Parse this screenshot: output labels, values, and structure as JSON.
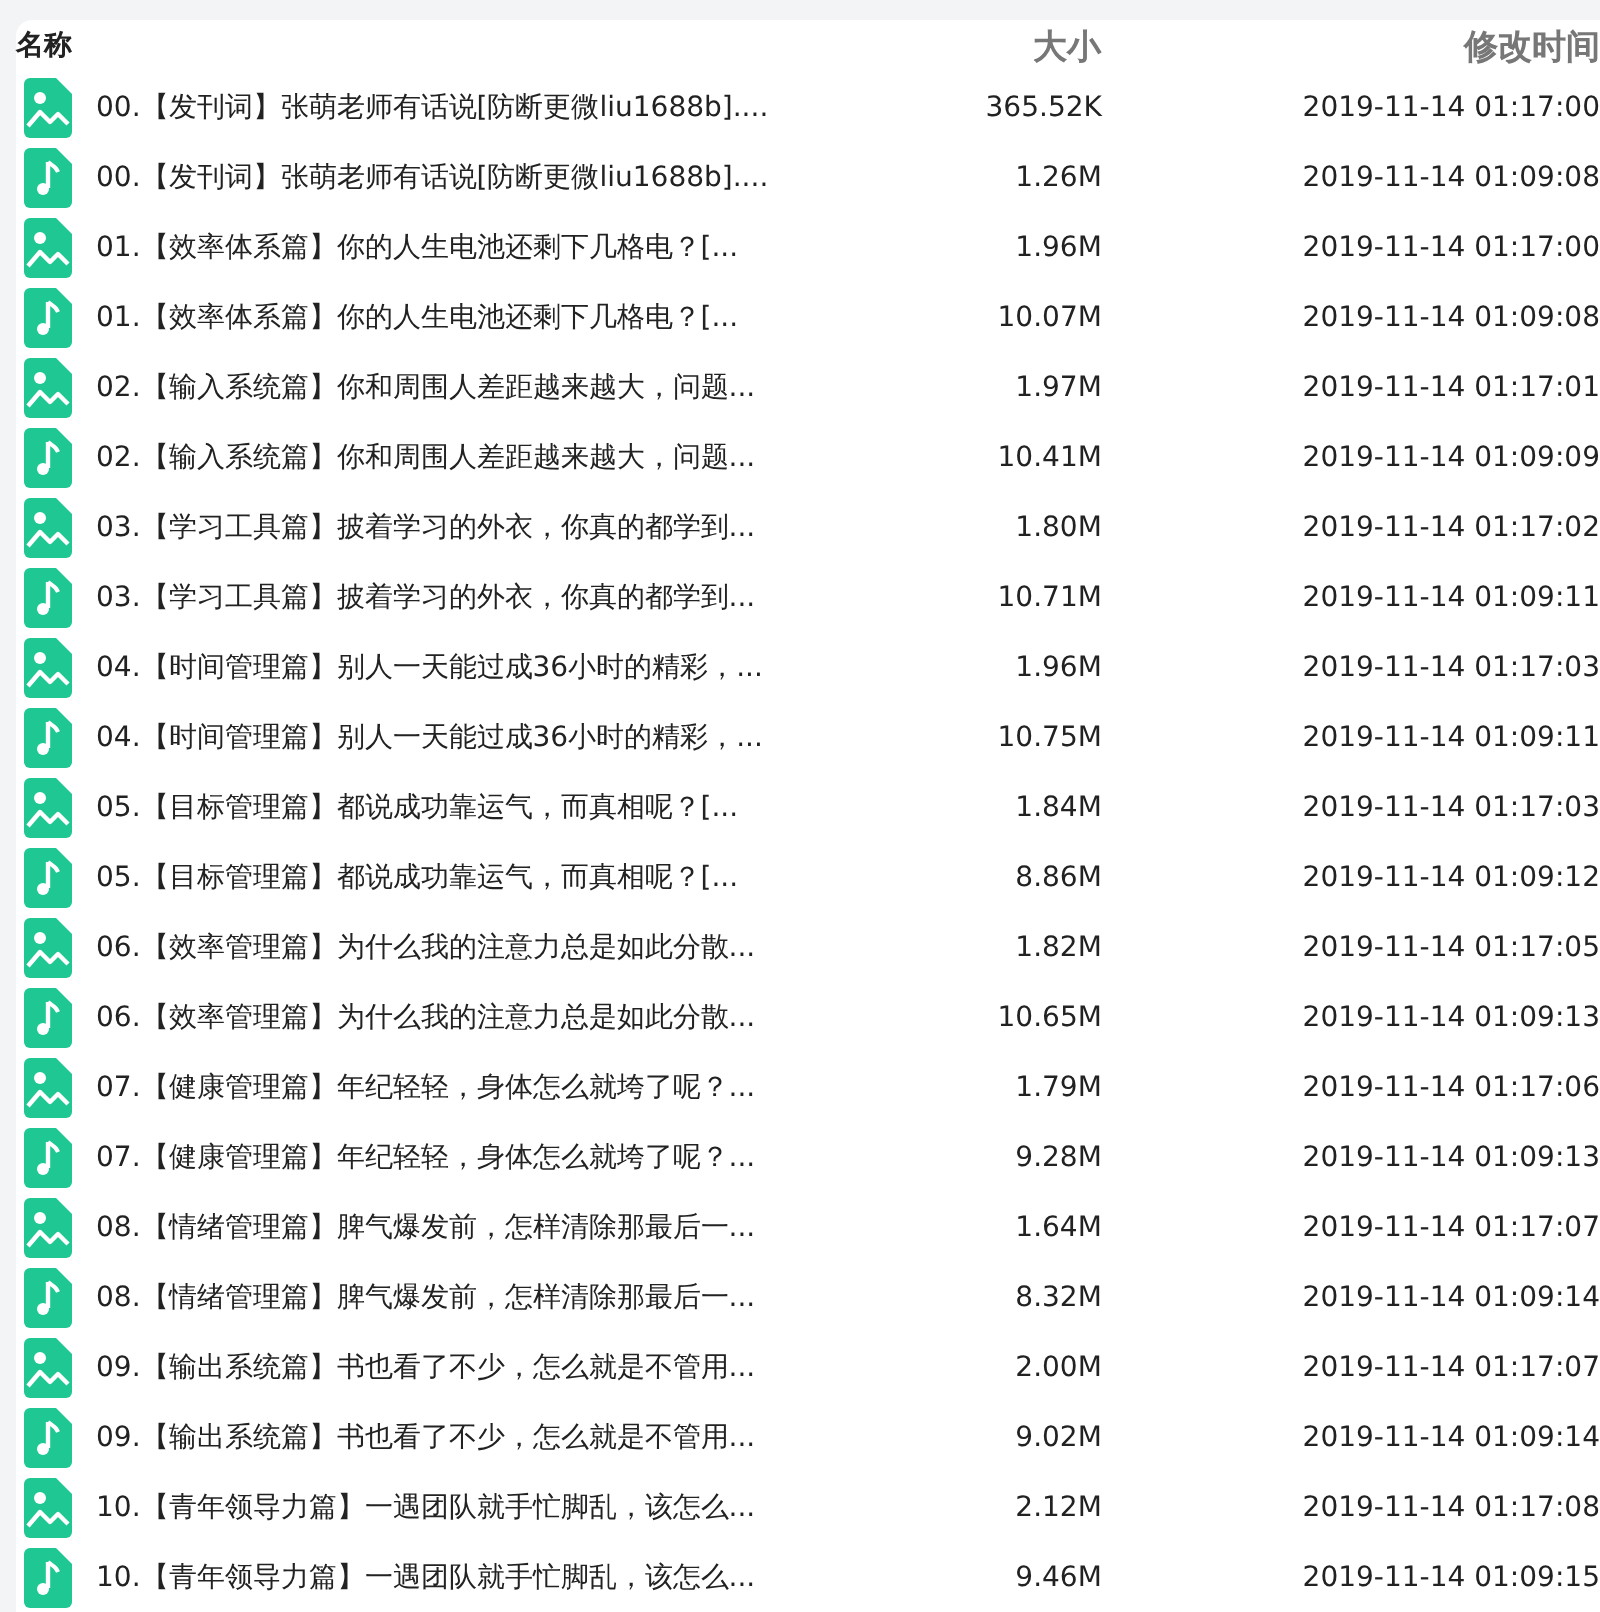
{
  "columns": [
    {
      "label": "名称"
    },
    {
      "label": "大小"
    },
    {
      "label": "修改时间"
    }
  ],
  "files": [
    {
      "kind": "image",
      "name": "00.【发刊词】张萌老师有话说[防断更微liu1688b]....",
      "size": "365.52K",
      "modified": "2019-11-14 01:17:00"
    },
    {
      "kind": "audio",
      "name": "00.【发刊词】张萌老师有话说[防断更微liu1688b]....",
      "size": "1.26M",
      "modified": "2019-11-14 01:09:08"
    },
    {
      "kind": "image",
      "name": "01.【效率体系篇】你的人生电池还剩下几格电？[...",
      "size": "1.96M",
      "modified": "2019-11-14 01:17:00"
    },
    {
      "kind": "audio",
      "name": "01.【效率体系篇】你的人生电池还剩下几格电？[...",
      "size": "10.07M",
      "modified": "2019-11-14 01:09:08"
    },
    {
      "kind": "image",
      "name": "02.【输入系统篇】你和周围人差距越来越大，问题...",
      "size": "1.97M",
      "modified": "2019-11-14 01:17:01"
    },
    {
      "kind": "audio",
      "name": "02.【输入系统篇】你和周围人差距越来越大，问题...",
      "size": "10.41M",
      "modified": "2019-11-14 01:09:09"
    },
    {
      "kind": "image",
      "name": "03.【学习工具篇】披着学习的外衣，你真的都学到...",
      "size": "1.80M",
      "modified": "2019-11-14 01:17:02"
    },
    {
      "kind": "audio",
      "name": "03.【学习工具篇】披着学习的外衣，你真的都学到...",
      "size": "10.71M",
      "modified": "2019-11-14 01:09:11"
    },
    {
      "kind": "image",
      "name": "04.【时间管理篇】别人一天能过成36小时的精彩，...",
      "size": "1.96M",
      "modified": "2019-11-14 01:17:03"
    },
    {
      "kind": "audio",
      "name": "04.【时间管理篇】别人一天能过成36小时的精彩，...",
      "size": "10.75M",
      "modified": "2019-11-14 01:09:11"
    },
    {
      "kind": "image",
      "name": "05.【目标管理篇】都说成功靠运气，而真相呢？[...",
      "size": "1.84M",
      "modified": "2019-11-14 01:17:03"
    },
    {
      "kind": "audio",
      "name": "05.【目标管理篇】都说成功靠运气，而真相呢？[...",
      "size": "8.86M",
      "modified": "2019-11-14 01:09:12"
    },
    {
      "kind": "image",
      "name": "06.【效率管理篇】为什么我的注意力总是如此分散...",
      "size": "1.82M",
      "modified": "2019-11-14 01:17:05"
    },
    {
      "kind": "audio",
      "name": "06.【效率管理篇】为什么我的注意力总是如此分散...",
      "size": "10.65M",
      "modified": "2019-11-14 01:09:13"
    },
    {
      "kind": "image",
      "name": "07.【健康管理篇】年纪轻轻，身体怎么就垮了呢？...",
      "size": "1.79M",
      "modified": "2019-11-14 01:17:06"
    },
    {
      "kind": "audio",
      "name": "07.【健康管理篇】年纪轻轻，身体怎么就垮了呢？...",
      "size": "9.28M",
      "modified": "2019-11-14 01:09:13"
    },
    {
      "kind": "image",
      "name": "08.【情绪管理篇】脾气爆发前，怎样清除那最后一...",
      "size": "1.64M",
      "modified": "2019-11-14 01:17:07"
    },
    {
      "kind": "audio",
      "name": "08.【情绪管理篇】脾气爆发前，怎样清除那最后一...",
      "size": "8.32M",
      "modified": "2019-11-14 01:09:14"
    },
    {
      "kind": "image",
      "name": "09.【输出系统篇】书也看了不少，怎么就是不管用...",
      "size": "2.00M",
      "modified": "2019-11-14 01:17:07"
    },
    {
      "kind": "audio",
      "name": "09.【输出系统篇】书也看了不少，怎么就是不管用...",
      "size": "9.02M",
      "modified": "2019-11-14 01:09:14"
    },
    {
      "kind": "image",
      "name": "10.【青年领导力篇】一遇团队就手忙脚乱，该怎么...",
      "size": "2.12M",
      "modified": "2019-11-14 01:17:08"
    },
    {
      "kind": "audio",
      "name": "10.【青年领导力篇】一遇团队就手忙脚乱，该怎么...",
      "size": "9.46M",
      "modified": "2019-11-14 01:09:15"
    }
  ]
}
